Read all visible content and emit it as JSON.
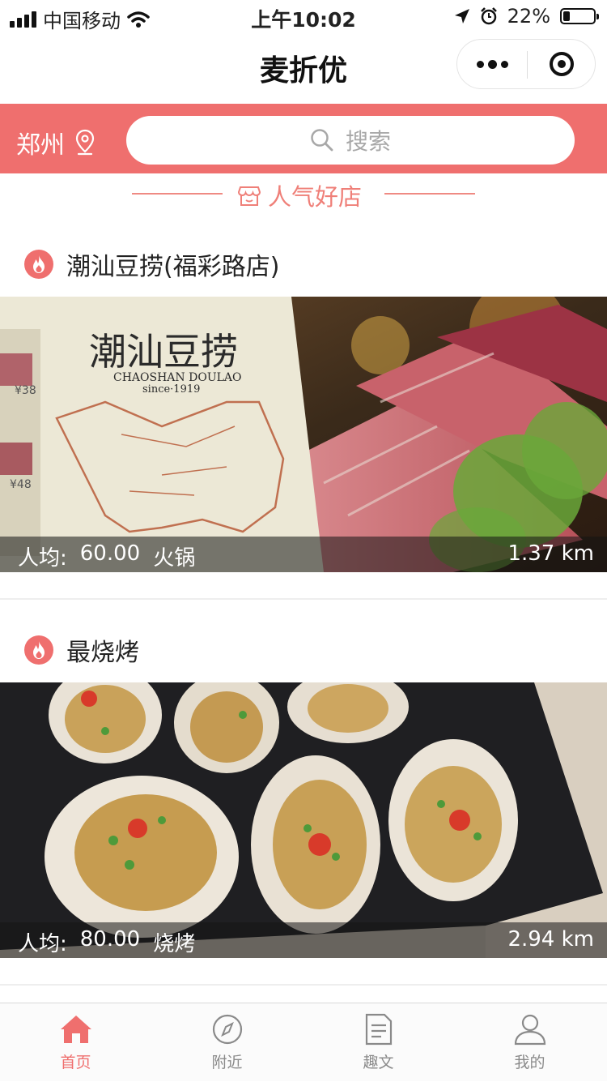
{
  "status_bar": {
    "carrier": "中国移动",
    "time": "上午10:02",
    "battery_percent": "22%",
    "battery_level": 0.22
  },
  "nav": {
    "title": "麦折优"
  },
  "header": {
    "city": "郑州",
    "search_placeholder": "搜索",
    "accent_color": "#ef6f6e"
  },
  "section": {
    "title": "人气好店"
  },
  "stores": [
    {
      "name": "潮汕豆捞(福彩路店)",
      "price_label": "人均:",
      "price": "60.00",
      "category": "火锅",
      "distance": "1.37 km",
      "image_menu_title": "潮汕豆捞",
      "image_menu_subtitle": "CHAOSHAN DOULAO",
      "image_menu_since": "since·1919"
    },
    {
      "name": "最烧烤",
      "price_label": "人均:",
      "price": "80.00",
      "category": "烧烤",
      "distance": "2.94 km"
    }
  ],
  "tabs": [
    {
      "label": "首页",
      "icon": "home-icon",
      "active": true
    },
    {
      "label": "附近",
      "icon": "compass-icon",
      "active": false
    },
    {
      "label": "趣文",
      "icon": "document-icon",
      "active": false
    },
    {
      "label": "我的",
      "icon": "user-icon",
      "active": false
    }
  ]
}
